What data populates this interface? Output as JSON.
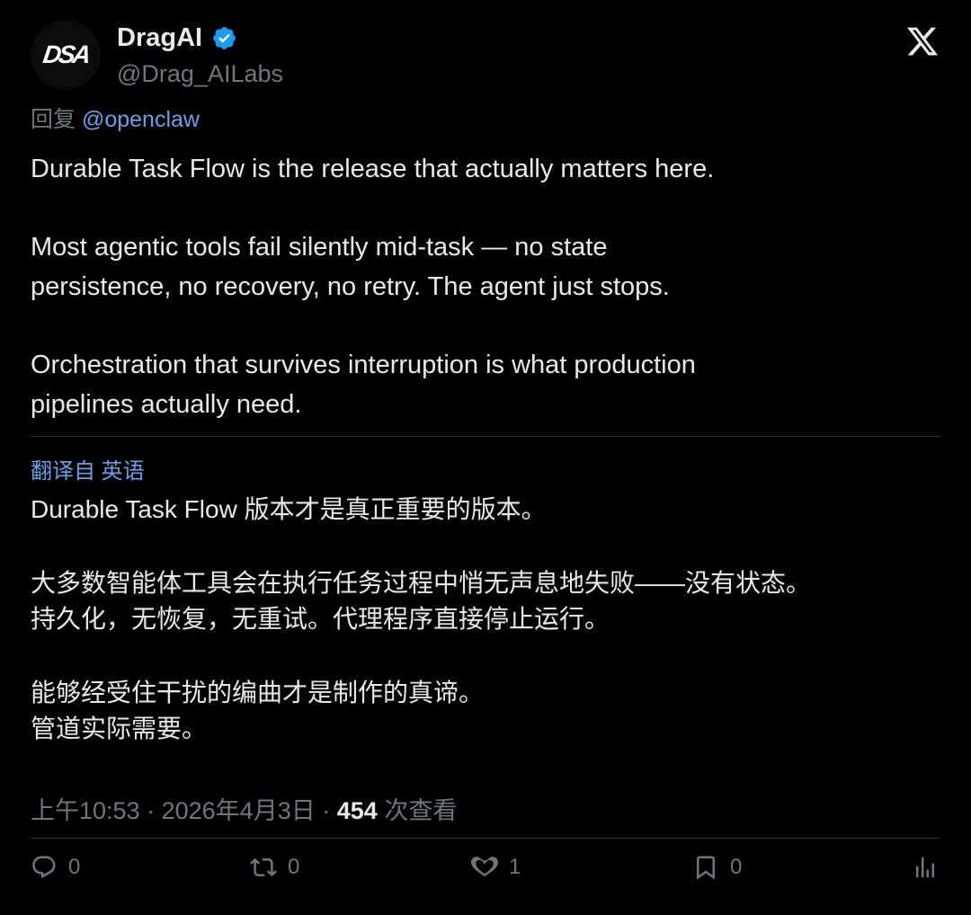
{
  "author": {
    "avatar_text": "DSA",
    "display_name": "DragAI",
    "handle": "@Drag_AILabs"
  },
  "reply": {
    "prefix": "回复",
    "mention": "@openclaw"
  },
  "tweet": {
    "paragraphs": [
      "Durable Task Flow is the release that actually matters here.",
      "Most agentic tools fail silently mid-task — no state persistence, no recovery, no retry. The agent just stops.",
      "Orchestration that survives interruption is what production pipelines actually need."
    ]
  },
  "translation": {
    "label": "翻译自 英语",
    "paragraphs": [
      "Durable Task Flow 版本才是真正重要的版本。",
      "大多数智能体工具会在执行任务过程中悄无声息地失败——没有状态。\n持久化，无恢复，无重试。代理程序直接停止运行。",
      "能够经受住干扰的编曲才是制作的真谛。\n管道实际需要。"
    ]
  },
  "meta": {
    "time": "上午10:53",
    "sep": "·",
    "date": "2026年4月3日",
    "views_count": "454",
    "views_label": "次查看"
  },
  "actions": {
    "replies": "0",
    "retweets": "0",
    "likes": "1",
    "bookmarks": "0"
  },
  "colors": {
    "background": "#000000",
    "text": "#e7e9ea",
    "secondary": "#71767b",
    "link": "#6f9fe6",
    "verified": "#1d9bf0"
  }
}
